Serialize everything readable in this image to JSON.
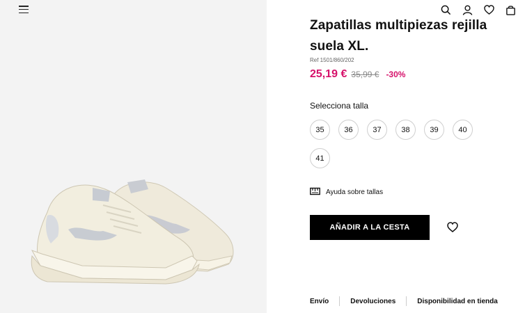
{
  "product": {
    "title": "Zapatillas multipiezas rejilla suela XL.",
    "ref": "Ref 1501/860/202",
    "price_now": "25,19 €",
    "price_old": "35,99 €",
    "discount": "-30%"
  },
  "sizes": {
    "label": "Selecciona talla",
    "options": [
      "35",
      "36",
      "37",
      "38",
      "39",
      "40",
      "41"
    ],
    "help_label": "Ayuda sobre tallas"
  },
  "actions": {
    "add_to_cart_label": "AÑADIR A LA CESTA"
  },
  "footer": {
    "links": [
      "Envío",
      "Devoluciones",
      "Disponibilidad en tienda"
    ]
  },
  "icons": {
    "menu": "menu-icon",
    "search": "search-icon",
    "account": "user-icon",
    "wishlist": "heart-icon",
    "bag": "bag-icon",
    "size_help": "ruler-icon"
  },
  "colors": {
    "accent": "#d6126b",
    "button_bg": "#000000",
    "image_bg": "#f3f3f3"
  }
}
